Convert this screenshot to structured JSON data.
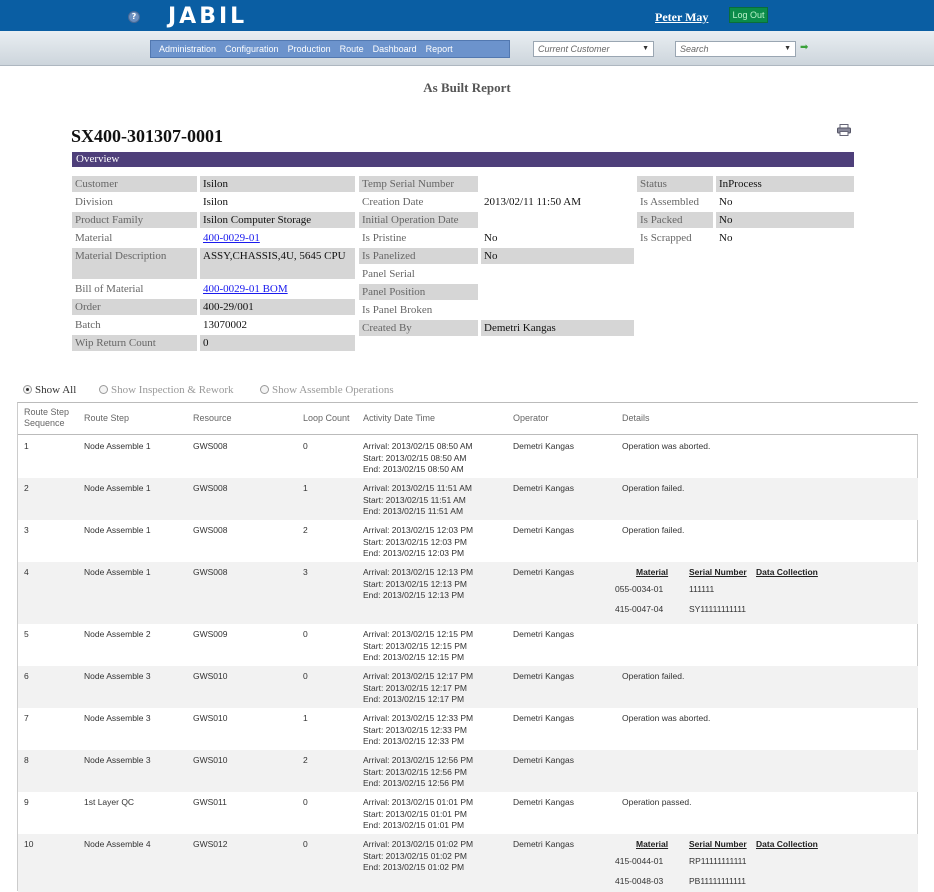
{
  "header": {
    "logo": "JABIL",
    "user": "Peter May",
    "logout_label": "Log Out"
  },
  "nav": {
    "menu": [
      "Administration",
      "Configuration",
      "Production",
      "Route",
      "Dashboard",
      "Report"
    ],
    "customer_select": "Current Customer",
    "search_placeholder": "Search"
  },
  "page": {
    "title": "As Built Report",
    "serial_number": "SX400-301307-0001",
    "overview_label": "Overview"
  },
  "overview": {
    "col1": [
      {
        "label": "Customer",
        "value": "Isilon"
      },
      {
        "label": "Division",
        "value": "Isilon"
      },
      {
        "label": "Product Family",
        "value": "Isilon Computer Storage"
      },
      {
        "label": "Material",
        "value": "400-0029-01"
      },
      {
        "label": "Material Description",
        "value": "ASSY,CHASSIS,4U, 5645 CPU"
      },
      {
        "label": "Bill of Material",
        "value": "400-0029-01 BOM"
      },
      {
        "label": "Order",
        "value": "400-29/001"
      },
      {
        "label": "Batch",
        "value": "13070002"
      },
      {
        "label": "Wip Return Count",
        "value": "0"
      }
    ],
    "col2": [
      {
        "label": "Temp Serial Number",
        "value": ""
      },
      {
        "label": "Creation Date",
        "value": "2013/02/11 11:50 AM"
      },
      {
        "label": "Initial Operation Date",
        "value": ""
      },
      {
        "label": "Is Pristine",
        "value": "No"
      },
      {
        "label": "Is Panelized",
        "value": "No"
      },
      {
        "label": "Panel Serial",
        "value": ""
      },
      {
        "label": "Panel Position",
        "value": ""
      },
      {
        "label": "Is Panel Broken",
        "value": ""
      },
      {
        "label": "Created By",
        "value": "Demetri Kangas"
      }
    ],
    "col3": [
      {
        "label": "Status",
        "value": "InProcess"
      },
      {
        "label": "Is Assembled",
        "value": "No"
      },
      {
        "label": "Is Packed",
        "value": "No"
      },
      {
        "label": "Is Scrapped",
        "value": "No"
      }
    ]
  },
  "filters": [
    "Show All",
    "Show Inspection & Rework",
    "Show Assemble Operations"
  ],
  "columns": [
    "Route Step Sequence",
    "Route Step",
    "Resource",
    "Loop Count",
    "Activity Date Time",
    "Operator",
    "Details"
  ],
  "material_headers": [
    "Material",
    "Serial Number",
    "Data Collection"
  ],
  "rows": [
    {
      "seq": "1",
      "step": "Node Assemble 1",
      "resource": "GWS008",
      "loop": "0",
      "arrival": "Arrival: 2013/02/15 08:50 AM",
      "start": "Start: 2013/02/15 08:50 AM",
      "end": "End: 2013/02/15 08:50 AM",
      "operator": "Demetri Kangas",
      "details": "Operation was aborted."
    },
    {
      "seq": "2",
      "step": "Node Assemble 1",
      "resource": "GWS008",
      "loop": "1",
      "arrival": "Arrival: 2013/02/15 11:51 AM",
      "start": "Start: 2013/02/15 11:51 AM",
      "end": "End: 2013/02/15 11:51 AM",
      "operator": "Demetri Kangas",
      "details": "Operation failed."
    },
    {
      "seq": "3",
      "step": "Node Assemble 1",
      "resource": "GWS008",
      "loop": "2",
      "arrival": "Arrival: 2013/02/15 12:03 PM",
      "start": "Start: 2013/02/15 12:03 PM",
      "end": "End: 2013/02/15 12:03 PM",
      "operator": "Demetri Kangas",
      "details": "Operation failed."
    },
    {
      "seq": "4",
      "step": "Node Assemble 1",
      "resource": "GWS008",
      "loop": "3",
      "arrival": "Arrival: 2013/02/15 12:13 PM",
      "start": "Start: 2013/02/15 12:13 PM",
      "end": "End: 2013/02/15 12:13 PM",
      "operator": "Demetri Kangas",
      "details": "",
      "materials": [
        {
          "material": "055-0034-01",
          "serial": "111111"
        },
        {
          "material": "415-0047-04",
          "serial": "SY11111111111"
        }
      ]
    },
    {
      "seq": "5",
      "step": "Node Assemble 2",
      "resource": "GWS009",
      "loop": "0",
      "arrival": "Arrival: 2013/02/15 12:15 PM",
      "start": "Start: 2013/02/15 12:15 PM",
      "end": "End: 2013/02/15 12:15 PM",
      "operator": "Demetri Kangas",
      "details": ""
    },
    {
      "seq": "6",
      "step": "Node Assemble 3",
      "resource": "GWS010",
      "loop": "0",
      "arrival": "Arrival: 2013/02/15 12:17 PM",
      "start": "Start: 2013/02/15 12:17 PM",
      "end": "End: 2013/02/15 12:17 PM",
      "operator": "Demetri Kangas",
      "details": "Operation failed."
    },
    {
      "seq": "7",
      "step": "Node Assemble 3",
      "resource": "GWS010",
      "loop": "1",
      "arrival": "Arrival: 2013/02/15 12:33 PM",
      "start": "Start: 2013/02/15 12:33 PM",
      "end": "End: 2013/02/15 12:33 PM",
      "operator": "Demetri Kangas",
      "details": "Operation was aborted."
    },
    {
      "seq": "8",
      "step": "Node Assemble 3",
      "resource": "GWS010",
      "loop": "2",
      "arrival": "Arrival: 2013/02/15 12:56 PM",
      "start": "Start: 2013/02/15 12:56 PM",
      "end": "End: 2013/02/15 12:56 PM",
      "operator": "Demetri Kangas",
      "details": ""
    },
    {
      "seq": "9",
      "step": "1st Layer QC",
      "resource": "GWS011",
      "loop": "0",
      "arrival": "Arrival: 2013/02/15 01:01 PM",
      "start": "Start: 2013/02/15 01:01 PM",
      "end": "End: 2013/02/15 01:01 PM",
      "operator": "Demetri Kangas",
      "details": "Operation passed."
    },
    {
      "seq": "10",
      "step": "Node Assemble 4",
      "resource": "GWS012",
      "loop": "0",
      "arrival": "Arrival: 2013/02/15 01:02 PM",
      "start": "Start: 2013/02/15 01:02 PM",
      "end": "End: 2013/02/15 01:02 PM",
      "operator": "Demetri Kangas",
      "details": "",
      "materials": [
        {
          "material": "415-0044-01",
          "serial": "RP11111111111"
        },
        {
          "material": "415-0048-03",
          "serial": "PB11111111111"
        }
      ]
    }
  ]
}
